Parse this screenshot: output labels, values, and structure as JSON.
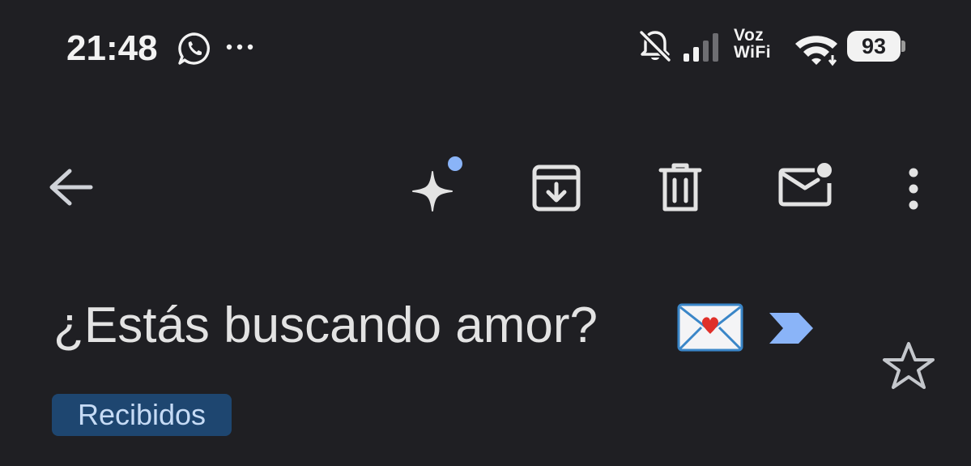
{
  "status_bar": {
    "time": "21:48",
    "voz_label": "Voz",
    "wifi_label": "WiFi",
    "battery_level": "93",
    "icons": [
      "whatsapp-icon",
      "more-notifications-icon",
      "bell-off-icon",
      "signal-icon",
      "wifi-icon",
      "battery-icon"
    ]
  },
  "toolbar": {
    "icons": [
      "back-arrow-icon",
      "gemini-sparkle-icon",
      "archive-icon",
      "delete-icon",
      "mark-unread-icon",
      "more-vert-icon"
    ]
  },
  "email": {
    "subject": "¿Estás buscando amor?",
    "subject_emoji": "love-letter-icon",
    "importance": "importance-marker-icon",
    "label": "Recibidos",
    "starred": false
  },
  "colors": {
    "background": "#1f1f23",
    "icon": "#e3e3e3",
    "accent_dot": "#8ab4f8",
    "label_bg": "#1e4670",
    "label_text": "#c6dbf5",
    "importance": "#8ab4f8"
  }
}
